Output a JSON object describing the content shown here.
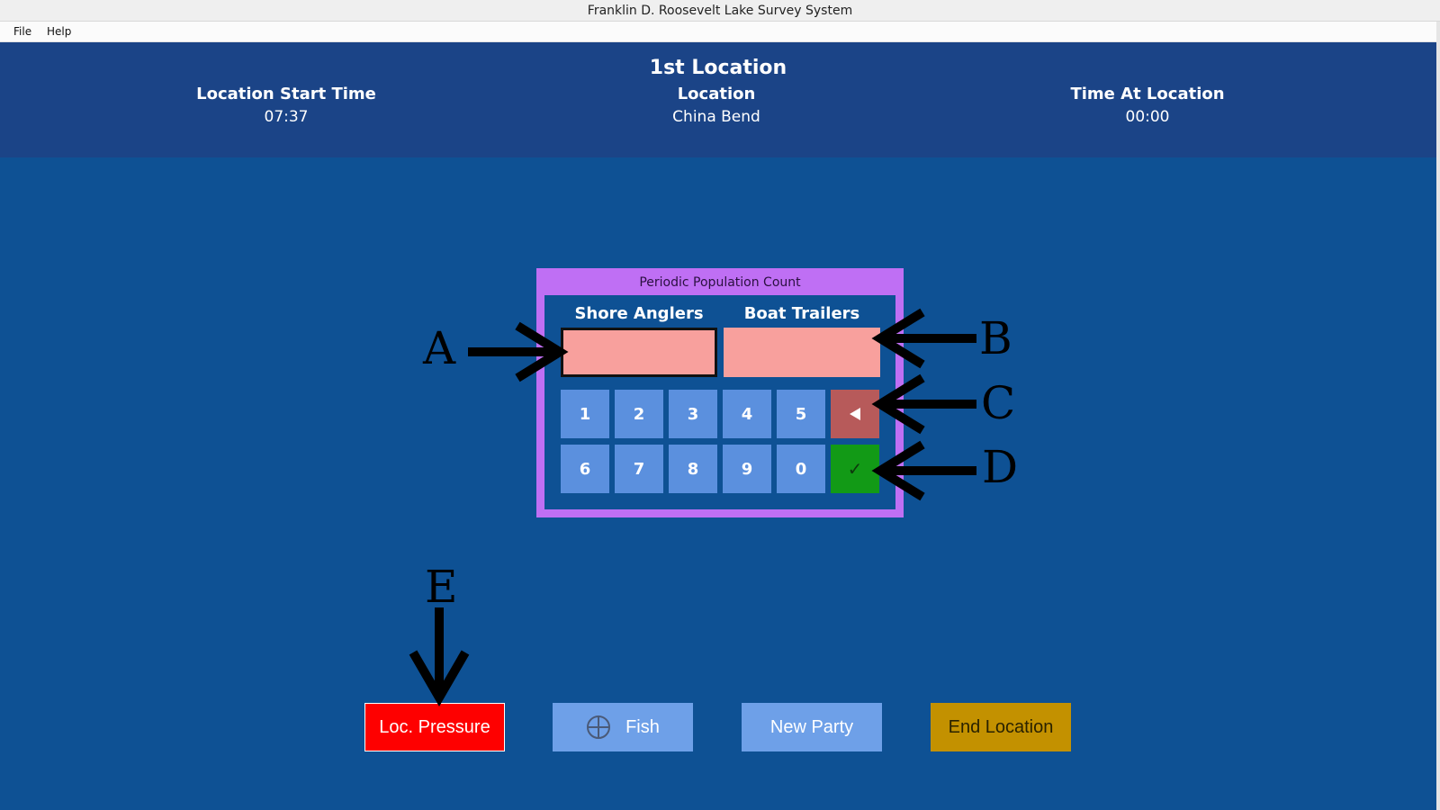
{
  "window": {
    "title": "Franklin D. Roosevelt Lake Survey System"
  },
  "menu": {
    "file": "File",
    "help": "Help"
  },
  "header": {
    "location_number": "1st Location",
    "start_label": "Location Start Time",
    "start_value": "07:37",
    "location_label": "Location",
    "location_value": "China Bend",
    "time_label": "Time At Location",
    "time_value": "00:00"
  },
  "count_panel": {
    "title": "Periodic Population Count",
    "shore_label": "Shore Anglers",
    "shore_value": "",
    "boat_label": "Boat Trailers",
    "boat_value": "",
    "keys_row1": [
      "1",
      "2",
      "3",
      "4",
      "5"
    ],
    "keys_row2": [
      "6",
      "7",
      "8",
      "9",
      "0"
    ],
    "backspace_icon": "backspace-triangle-icon",
    "enter_glyph": "✓"
  },
  "buttons": {
    "pressure": "Loc. Pressure",
    "fish": "Fish",
    "fish_icon": "crosshair-circle-icon",
    "new_party": "New Party",
    "end_location": "End Location"
  },
  "annotations": {
    "a": "A",
    "b": "B",
    "c": "C",
    "d": "D",
    "e": "E"
  },
  "colors": {
    "background": "#0e5194",
    "header": "#1b4487",
    "panel_border": "#bf6ff4",
    "input": "#f8a09d",
    "key": "#5b90de",
    "backspace": "#b75a5a",
    "enter": "#129a16",
    "pressure": "#fe0000",
    "secondary_button": "#6ea0e8",
    "end_location": "#c39100"
  }
}
